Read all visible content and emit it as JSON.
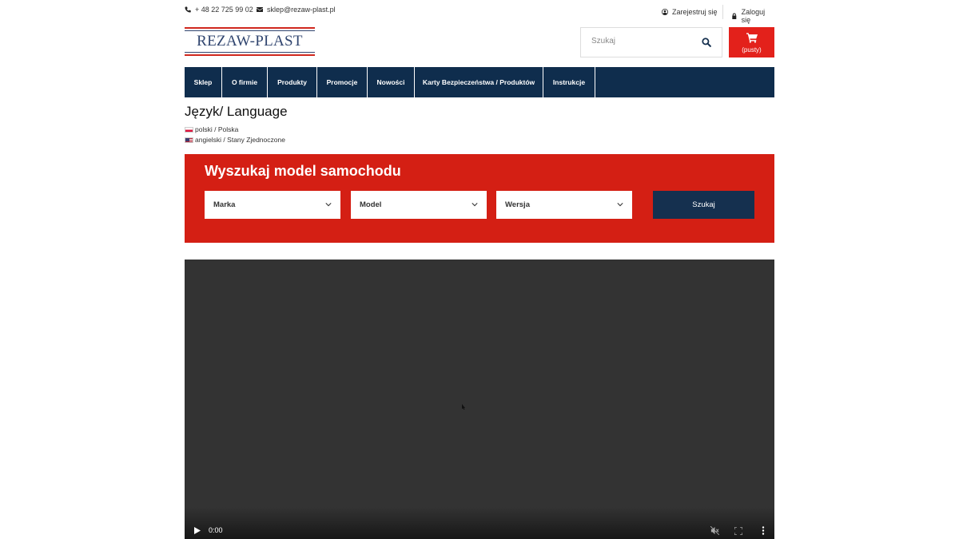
{
  "topbar": {
    "phone": "+ 48 22 725 99 02",
    "email": "sklep@rezaw-plast.pl",
    "register_label": "Zarejestruj się",
    "login_label": "Zaloguj się"
  },
  "header": {
    "logo_text": "REZAW-PLAST",
    "search_placeholder": "Szukaj",
    "cart_label": "(pusty)"
  },
  "nav": {
    "items": [
      "Sklep",
      "O firmie",
      "Produkty",
      "Promocje",
      "Nowości",
      "Karty Bezpieczeństwa / Produktów",
      "Instrukcje"
    ]
  },
  "language": {
    "title": "Język/ Language",
    "options": [
      "polski / Polska",
      "angielski / Stany Zjednoczone"
    ]
  },
  "car_finder": {
    "title": "Wyszukaj model samochodu",
    "brand_label": "Marka",
    "model_label": "Model",
    "version_label": "Wersja",
    "search_button": "Szukaj"
  },
  "video": {
    "time": "0:00"
  },
  "colors": {
    "brand_red": "#d41f14",
    "nav_navy": "#0f2d4d",
    "cart_red": "#e3211b",
    "button_navy": "#15304f"
  }
}
